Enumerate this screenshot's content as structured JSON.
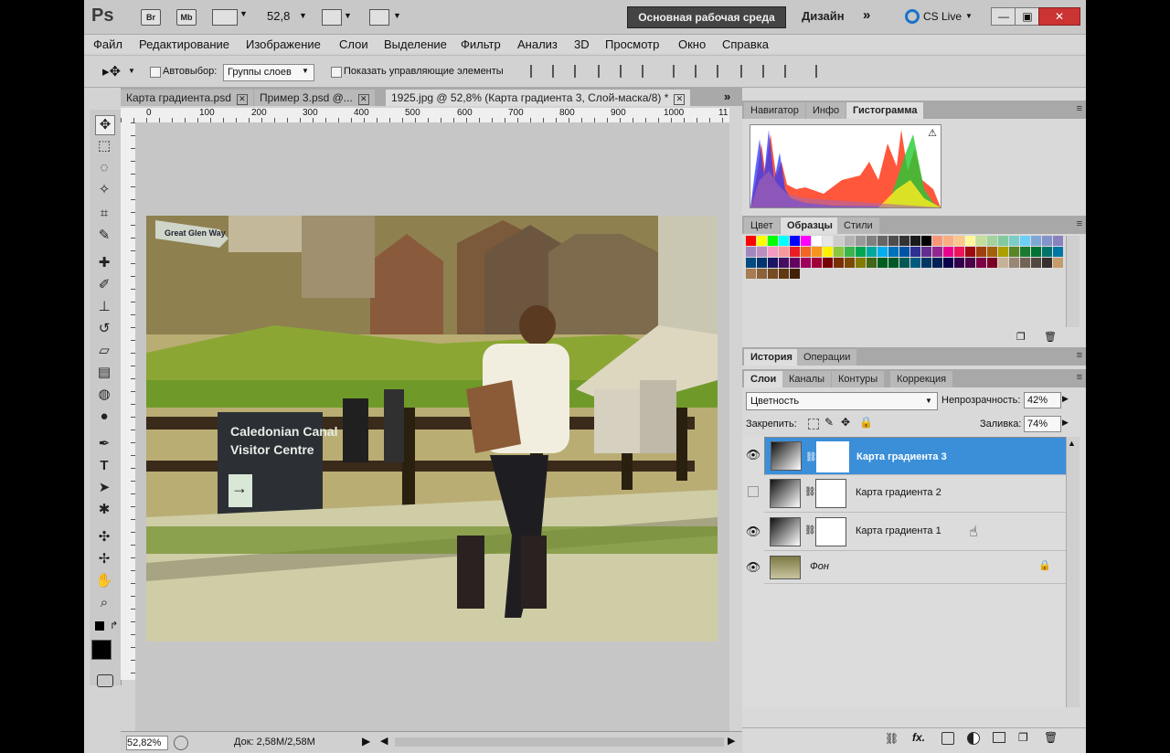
{
  "appbar": {
    "logo": "Ps",
    "br": "Br",
    "mb": "Mb",
    "zoom": "52,8",
    "workspace_active": "Основная рабочая среда",
    "workspace_design": "Дизайн",
    "more": "»",
    "cs_live": "CS Live",
    "minimize": "—",
    "maximize": "▣",
    "close": "✕"
  },
  "menu": [
    "Файл",
    "Редактирование",
    "Изображение",
    "Слои",
    "Выделение",
    "Фильтр",
    "Анализ",
    "3D",
    "Просмотр",
    "Окно",
    "Справка"
  ],
  "options": {
    "autoselect_label": "Автовыбор:",
    "autoselect_value": "Группы слоев",
    "show_controls_label": "Показать управляющие элементы"
  },
  "tabs": [
    {
      "label": "Карта градиента.psd"
    },
    {
      "label": "Пример 3.psd @..."
    },
    {
      "label": "1925.jpg @ 52,8% (Карта градиента 3, Слой-маска/8) *"
    }
  ],
  "ruler_numbers": [
    "0",
    "100",
    "200",
    "300",
    "400",
    "500",
    "600",
    "700",
    "800",
    "900",
    "1000",
    "11"
  ],
  "photo": {
    "sign_line1": "Caledonian Canal",
    "sign_line2": "Visitor Centre",
    "arrow": "→",
    "street_sign": "Great Glen Way"
  },
  "statusbar": {
    "zoom": "52,82%",
    "doc": "Док: 2,58M/2,58M"
  },
  "panels": {
    "group1_tabs": [
      "Навигатор",
      "Инфо",
      "Гистограмма"
    ],
    "group2_tabs": [
      "Цвет",
      "Образцы",
      "Стили"
    ],
    "group3_tabs": [
      "История",
      "Операции"
    ],
    "group4_tabs": [
      "Слои",
      "Каналы",
      "Контуры",
      "Коррекция"
    ],
    "menu_icon": "≡"
  },
  "layers_panel": {
    "blend_mode": "Цветность",
    "opacity_label": "Непрозрачность:",
    "opacity_value": "42%",
    "lock_label": "Закрепить:",
    "fill_label": "Заливка:",
    "fill_value": "74%",
    "layers": [
      {
        "name": "Карта градиента 3",
        "visible": true,
        "selected": true
      },
      {
        "name": "Карта градиента 2",
        "visible": false,
        "selected": false
      },
      {
        "name": "Карта градиента 1",
        "visible": true,
        "selected": false
      },
      {
        "name": "Фон",
        "visible": true,
        "selected": false
      }
    ],
    "bottom_icons": [
      "link-icon",
      "fx-icon",
      "mask-icon",
      "adjustment-icon",
      "folder-icon",
      "new-layer-icon",
      "trash-icon"
    ]
  },
  "swatch_colors": [
    "#ff0000",
    "#ffff00",
    "#00ff00",
    "#00ffff",
    "#0000ff",
    "#ff00ff",
    "#ffffff",
    "#e6e6e6",
    "#cccccc",
    "#b3b3b3",
    "#999999",
    "#808080",
    "#666666",
    "#4d4d4d",
    "#333333",
    "#1a1a1a",
    "#000000",
    "#f7977a",
    "#f9ad81",
    "#fdc68a",
    "#fff79a",
    "#c4df9b",
    "#a2d39c",
    "#82ca9d",
    "#7bcdc8",
    "#6ecff6",
    "#7ea7d8",
    "#8493ca",
    "#8882be",
    "#a187be",
    "#bc8dbf",
    "#f49ac2",
    "#f6989d",
    "#ed1c24",
    "#f26522",
    "#f7941d",
    "#fff200",
    "#8dc63f",
    "#39b54a",
    "#00a651",
    "#00a99d",
    "#00aeef",
    "#0072bc",
    "#0054a6",
    "#2e3192",
    "#662d91",
    "#92278f",
    "#ec008c",
    "#ed145b",
    "#9e0b0f",
    "#a0410d",
    "#a36209",
    "#aba000",
    "#598527",
    "#1a7b30",
    "#007236",
    "#00746b",
    "#0076a3",
    "#004b80",
    "#003471",
    "#1b1464",
    "#440e62",
    "#630460",
    "#9e005d",
    "#9e0039",
    "#790000",
    "#7b2e00",
    "#7d4900",
    "#827b00",
    "#406618",
    "#005e20",
    "#005826",
    "#005952",
    "#005b7f",
    "#003663",
    "#002157",
    "#0d004c",
    "#32004b",
    "#4b0049",
    "#7b0046",
    "#7a0026",
    "#c7b299",
    "#998675",
    "#736357",
    "#534741",
    "#362f2d",
    "#c69c6d",
    "#a67c52",
    "#8c6239",
    "#754c24",
    "#603913",
    "#42210b"
  ]
}
